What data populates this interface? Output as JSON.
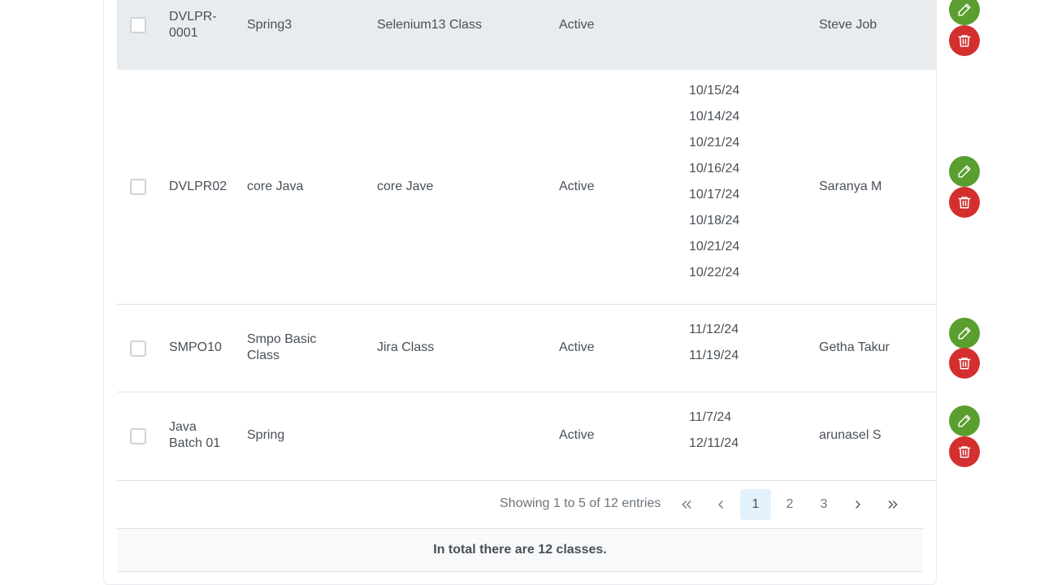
{
  "rows": [
    {
      "code": "DVLPR-\n0001",
      "name": "Spring3",
      "description": "Selenium13 Class",
      "status": "Active",
      "dates": [],
      "staff": "Steve Job"
    },
    {
      "code": "DVLPR02",
      "name": "core Java",
      "description": "core Jave",
      "status": "Active",
      "dates": [
        "10/15/24",
        "10/14/24",
        "10/21/24",
        "10/16/24",
        "10/17/24",
        "10/18/24",
        "10/21/24",
        "10/22/24"
      ],
      "staff": "Saranya M"
    },
    {
      "code": "SMPO10",
      "name": "Smpo Basic\nClass",
      "description": "Jira Class",
      "status": "Active",
      "dates": [
        "11/12/24",
        "11/19/24"
      ],
      "staff": "Getha Takur"
    },
    {
      "code": "Java\nBatch 01",
      "name": "Spring",
      "description": "",
      "status": "Active",
      "dates": [
        "11/7/24",
        "12/11/24"
      ],
      "staff": "arunasel S"
    }
  ],
  "pagination": {
    "summary": "Showing 1 to 5 of 12 entries",
    "first": "«",
    "prev": "‹",
    "next": "›",
    "last": "»",
    "pages": [
      "1",
      "2",
      "3"
    ]
  },
  "footer": {
    "text": "In total there are 12 classes."
  },
  "colors": {
    "edit": "#5a9e2f",
    "delete": "#d32f2f",
    "highlight": "#e9ecef"
  }
}
